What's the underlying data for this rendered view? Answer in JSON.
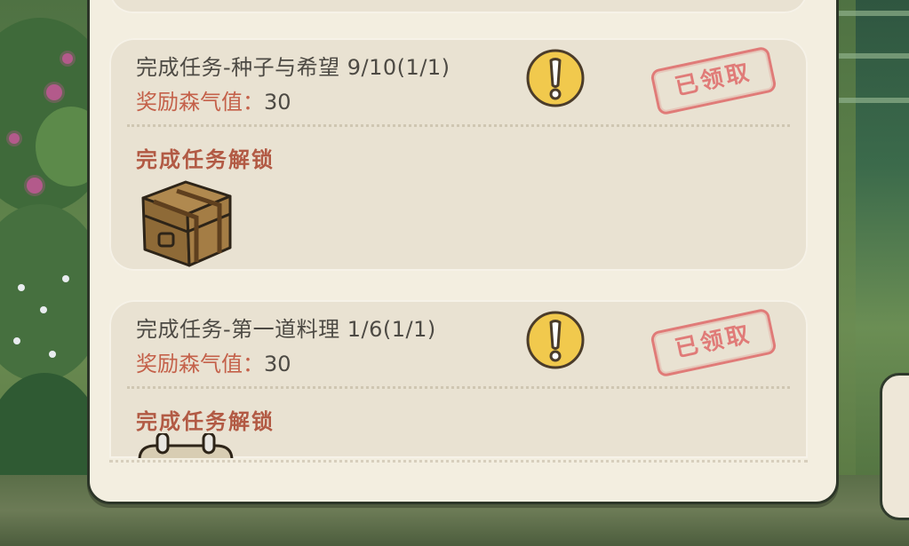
{
  "tasks": [
    {
      "title": "完成任务-种子与希望 9/10(1/1)",
      "reward_label": "奖励森气值：",
      "reward_value": "30",
      "status": "已领取",
      "unlock_label": "完成任务解锁",
      "reward_icon": "leather-chest-icon"
    },
    {
      "title": "完成任务-第一道料理 1/6(1/1)",
      "reward_label": "奖励森气值：",
      "reward_value": "30",
      "status": "已领取",
      "unlock_label": "完成任务解锁",
      "reward_icon": "pot-icon"
    }
  ],
  "colors": {
    "panel_bg": "#f3eee0",
    "card_bg": "#e9e2d2",
    "reward_label": "#c4614a",
    "unlock_label": "#b25a44",
    "stamp": "#e07b78",
    "alert_fill": "#f1c94d"
  }
}
